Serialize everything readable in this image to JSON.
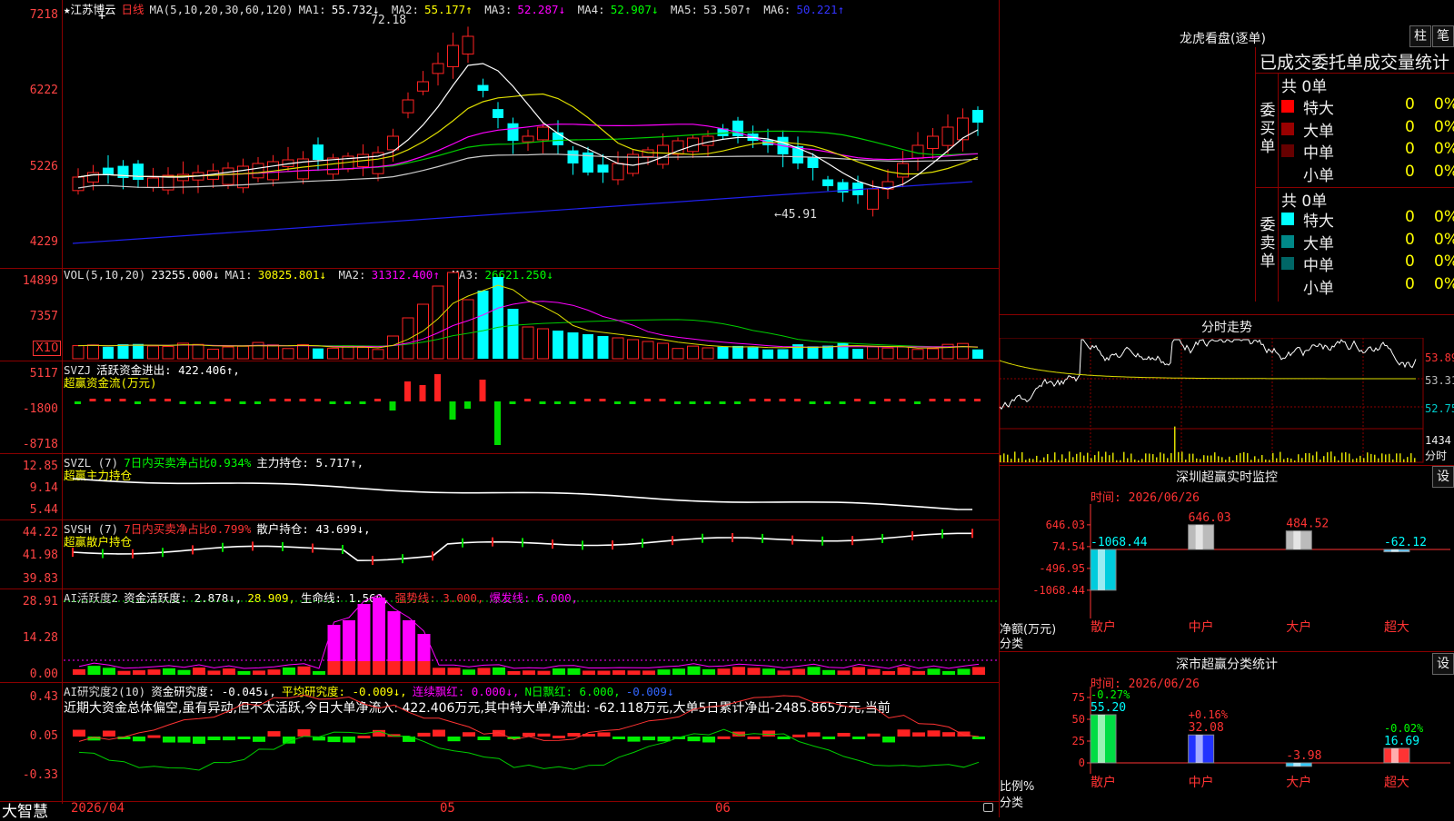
{
  "main": {
    "stock": "★江苏博云",
    "period": "日线",
    "ma_label": "MA(5,10,20,30,60,120)",
    "ma": [
      {
        "label": "MA1:",
        "value": "55.732↓",
        "color": "#ffffff"
      },
      {
        "label": "MA2:",
        "value": "55.177↑",
        "color": "#ffff00"
      },
      {
        "label": "MA3:",
        "value": "52.287↓",
        "color": "#ff00ff"
      },
      {
        "label": "MA4:",
        "value": "52.907↓",
        "color": "#00ff00"
      },
      {
        "label": "MA5:",
        "value": "53.507↑",
        "color": "#dddddd"
      },
      {
        "label": "MA6:",
        "value": "50.221↑",
        "color": "#3333ff"
      }
    ],
    "y_ticks": [
      "7218",
      "6222",
      "5226",
      "4229"
    ],
    "high_marker": "72.18",
    "low_marker": "←45.91"
  },
  "vol": {
    "label": "VOL(5,10,20)",
    "value": "23255.000↓",
    "ma": [
      {
        "label": "MA1:",
        "value": "30825.801↓",
        "color": "#ffff00"
      },
      {
        "label": "MA2:",
        "value": "31312.400↑",
        "color": "#ff00ff"
      },
      {
        "label": "MA3:",
        "value": "26621.250↓",
        "color": "#00ff00"
      }
    ],
    "y_ticks": [
      "14899",
      "7357"
    ],
    "unit": "X10"
  },
  "svzj": {
    "label": "SVZJ",
    "field": "活跃资金进出: 422.406↑,",
    "subtitle": "超赢资金流(万元)",
    "y_ticks": [
      "5117",
      "-1800",
      "-8718"
    ]
  },
  "svzl": {
    "label": "SVZL (7)",
    "field1": "7日内买卖净占比0.934%",
    "field2": "主力持仓: 5.717↑,",
    "subtitle": "超赢主力持仓",
    "y_ticks": [
      "12.85",
      "9.14",
      "5.44"
    ]
  },
  "svsh": {
    "label": "SVSH (7)",
    "field1": "7日内买卖净占比0.799%",
    "field2": "散户持仓: 43.699↓,",
    "subtitle": "超赢散户持仓",
    "y_ticks": [
      "44.22",
      "41.98",
      "39.83"
    ]
  },
  "ai_active": {
    "label": "AI活跃度2",
    "field1": "资金活跃度: 2.878↓,",
    "field2": "28.909,",
    "field3": "生命线: 1.560,",
    "field4": "强势线: 3.000,",
    "field5": "爆发线: 6.000,",
    "y_ticks": [
      "28.91",
      "14.28",
      "0.00"
    ]
  },
  "ai_research": {
    "label": "AI研究度2(10)",
    "field1": "资金研究度: -0.045↓,",
    "field2": "平均研究度: -0.009↓,",
    "field3": "连续飘红: 0.000↓,",
    "field4": "N日飘红: 6.000,",
    "field5": "-0.009↓",
    "comment": "近期大资金总体偏空,虽有异动,但不太活跃,今日大单净流入: 422.406万元,其中特大单净流出: -62.118万元,大单5日累计净出-2485.865万元,当前",
    "y_ticks": [
      "0.43",
      "0.05",
      "-0.33"
    ]
  },
  "bottom": {
    "brand": "大智慧",
    "date": "2026/04",
    "month1": "05",
    "month2": "06"
  },
  "right": {
    "dragon_title": "龙虎看盘(逐单)",
    "btn1": "柱",
    "btn2": "笔",
    "stats_title": "已成交委托单成交量统计",
    "buy_side": "委买单",
    "sell_side": "委卖单",
    "buy_total": "共 0单",
    "sell_total": "共 0单",
    "buy_rows": [
      {
        "name": "特大",
        "v1": "0",
        "v2": "0%",
        "color": "#ff0000"
      },
      {
        "name": "大单",
        "v1": "0",
        "v2": "0%",
        "color": "#990000"
      },
      {
        "name": "中单",
        "v1": "0",
        "v2": "0%",
        "color": "#660000"
      },
      {
        "name": "小单",
        "v1": "0",
        "v2": "0%",
        "color": "#000000"
      }
    ],
    "sell_rows": [
      {
        "name": "特大",
        "v1": "0",
        "v2": "0%",
        "color": "#00ffff"
      },
      {
        "name": "大单",
        "v1": "0",
        "v2": "0%",
        "color": "#008888"
      },
      {
        "name": "中单",
        "v1": "0",
        "v2": "0%",
        "color": "#006666"
      },
      {
        "name": "小单",
        "v1": "0",
        "v2": "0%",
        "color": "#000000"
      }
    ],
    "intraday_title": "分时走势",
    "intraday_ticks": [
      "53.89",
      "53.31",
      "52.75"
    ],
    "intraday_vol": "1434",
    "intraday_vol_label": "分时",
    "sz_title": "深圳超赢实时监控",
    "sz_btn": "设",
    "sz_time": "时间: 2026/06/26",
    "sz_ticks": [
      "646.03",
      "74.54",
      "-496.95",
      "-1068.44"
    ],
    "sz_y_title": "净额(万元)",
    "sz_x_title": "分类",
    "sz_cats": [
      "散户",
      "中户",
      "大户",
      "超大"
    ],
    "sz_values": [
      "-1068.44",
      "646.03",
      "484.52",
      "-62.12"
    ],
    "stat_title": "深市超赢分类统计",
    "stat_btn": "设",
    "stat_time": "时间: 2026/06/26",
    "stat_ticks": [
      "75",
      "50",
      "25",
      "0"
    ],
    "stat_y_title": "比例%",
    "stat_x_title": "分类",
    "stat_cats": [
      "散户",
      "中户",
      "大户",
      "超大"
    ],
    "stat_values": [
      "55.20",
      "32.08",
      "-3.98",
      "16.69"
    ],
    "stat_deltas": [
      "-0.27%",
      "+0.16%",
      "",
      "-0.02%"
    ]
  }
}
